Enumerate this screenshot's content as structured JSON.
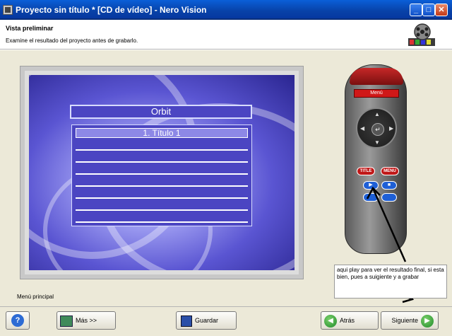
{
  "window": {
    "title": "Proyecto sin título * [CD de vídeo] - Nero Vision",
    "minimize": "_",
    "maximize": "□",
    "close": "✕"
  },
  "header": {
    "title": "Vista preliminar",
    "subtitle": "Examine el resultado del proyecto antes de grabarlo."
  },
  "preview": {
    "menu_title": "Orbit",
    "items": [
      "1. Título 1"
    ],
    "status": "Menú principal"
  },
  "remote": {
    "menu_label": "Menú",
    "title_btn": "TITLE",
    "menu_btn": "MENU",
    "play_symbol": "▶",
    "stop_symbol": "■"
  },
  "annotation": {
    "text": "aqui play para ver el resultado final, si esta bien, pues a suigiente y a grabar"
  },
  "buttons": {
    "help": "?",
    "more": "Más >>",
    "save": "Guardar",
    "back": "Atrás",
    "next": "Siguiente"
  },
  "colors": {
    "titlebar": "#0842a8",
    "menu_background": "#4b45c2",
    "remote_accent": "#d01818"
  },
  "icons": [
    "app-icon",
    "film-reel-logo",
    "help-icon",
    "more-icon",
    "save-icon",
    "back-arrow-icon",
    "next-arrow-icon"
  ]
}
